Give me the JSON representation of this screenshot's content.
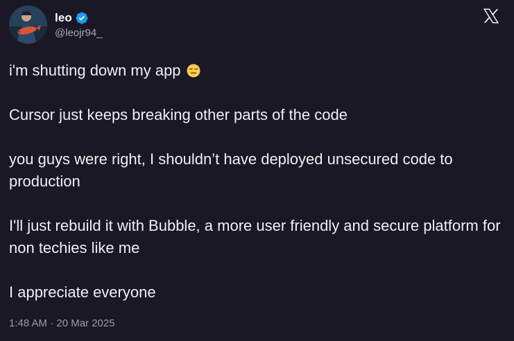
{
  "author": {
    "display_name": "leo",
    "handle": "@leojr94_",
    "verified": true,
    "avatar_icon": "avatar-fisherman-photo"
  },
  "brand": {
    "logo_icon": "x-logo-icon"
  },
  "tweet": {
    "paragraphs": [
      "i'm shutting down my app",
      "Cursor just keeps breaking other parts of the code",
      "you guys were right, I shouldn’t have deployed unsecured code to production",
      "I'll just rebuild it with Bubble, a more user friendly and secure platform for non techies like me",
      "I appreciate everyone"
    ],
    "emoji": "expressionless-face-emoji",
    "timestamp": "1:48 AM · 20 Mar 2025"
  },
  "colors": {
    "background": "#1a1824",
    "text": "#eef0f4",
    "secondary_text": "#9a9dab",
    "verified_badge": "#1d9bf0"
  }
}
